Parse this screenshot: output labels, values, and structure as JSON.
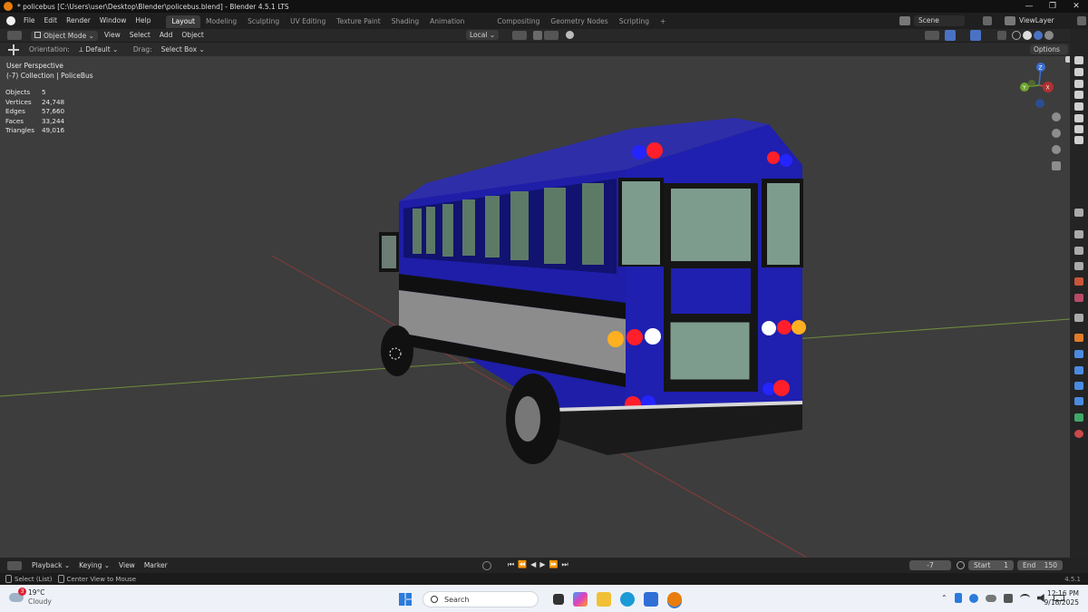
{
  "window": {
    "title": "* policebus [C:\\Users\\user\\Desktop\\Blender\\policebus.blend] - Blender 4.5.1 LTS",
    "controls": [
      "—",
      "❐",
      "✕"
    ]
  },
  "menubar": {
    "menus": [
      "File",
      "Edit",
      "Render",
      "Window",
      "Help"
    ],
    "workspaces": [
      "Layout",
      "Modeling",
      "Sculpting",
      "UV Editing",
      "Texture Paint",
      "Shading",
      "Animation",
      "Compositing",
      "Geometry Nodes",
      "Scripting"
    ],
    "active_workspace": "Layout",
    "add_tab": "+",
    "scene": "Scene",
    "view_layer": "ViewLayer"
  },
  "header": {
    "mode": "Object Mode",
    "menus": [
      "View",
      "Select",
      "Add",
      "Object"
    ],
    "pivot": "Local"
  },
  "tool_options": {
    "orientation_label": "Orientation:",
    "orientation_value": "Default",
    "drag_label": "Drag:",
    "drag_value": "Select Box",
    "options": "Options"
  },
  "viewport": {
    "perspective": "User Perspective",
    "collection": "(-7) Collection | PoliceBus",
    "stats": [
      {
        "label": "Objects",
        "value": "5"
      },
      {
        "label": "Vertices",
        "value": "24,748"
      },
      {
        "label": "Edges",
        "value": "57,660"
      },
      {
        "label": "Faces",
        "value": "33,244"
      },
      {
        "label": "Triangles",
        "value": "49,016"
      }
    ],
    "gizmo_axes": [
      "Z",
      "Y",
      "X"
    ],
    "colors": {
      "background": "#3d3d3d",
      "bus_body": "#1f1fb0",
      "stripe": "#8a8a8a",
      "light_red": "#ff1f2a",
      "light_blue": "#2020ff",
      "light_amber": "#ffb020"
    }
  },
  "timeline": {
    "menus": [
      "Playback",
      "Keying",
      "View",
      "Marker"
    ],
    "current_frame": "-7",
    "start_label": "Start",
    "start_value": "1",
    "end_label": "End",
    "end_value": "150"
  },
  "statusbar": {
    "left1": "Select (List)",
    "left2": "Center View to Mouse",
    "version": "4.5.1"
  },
  "taskbar": {
    "weather_badge": "3",
    "temperature": "19°C",
    "condition": "Cloudy",
    "search_placeholder": "Search",
    "time": "12:16 PM",
    "date": "9/18/2025"
  }
}
